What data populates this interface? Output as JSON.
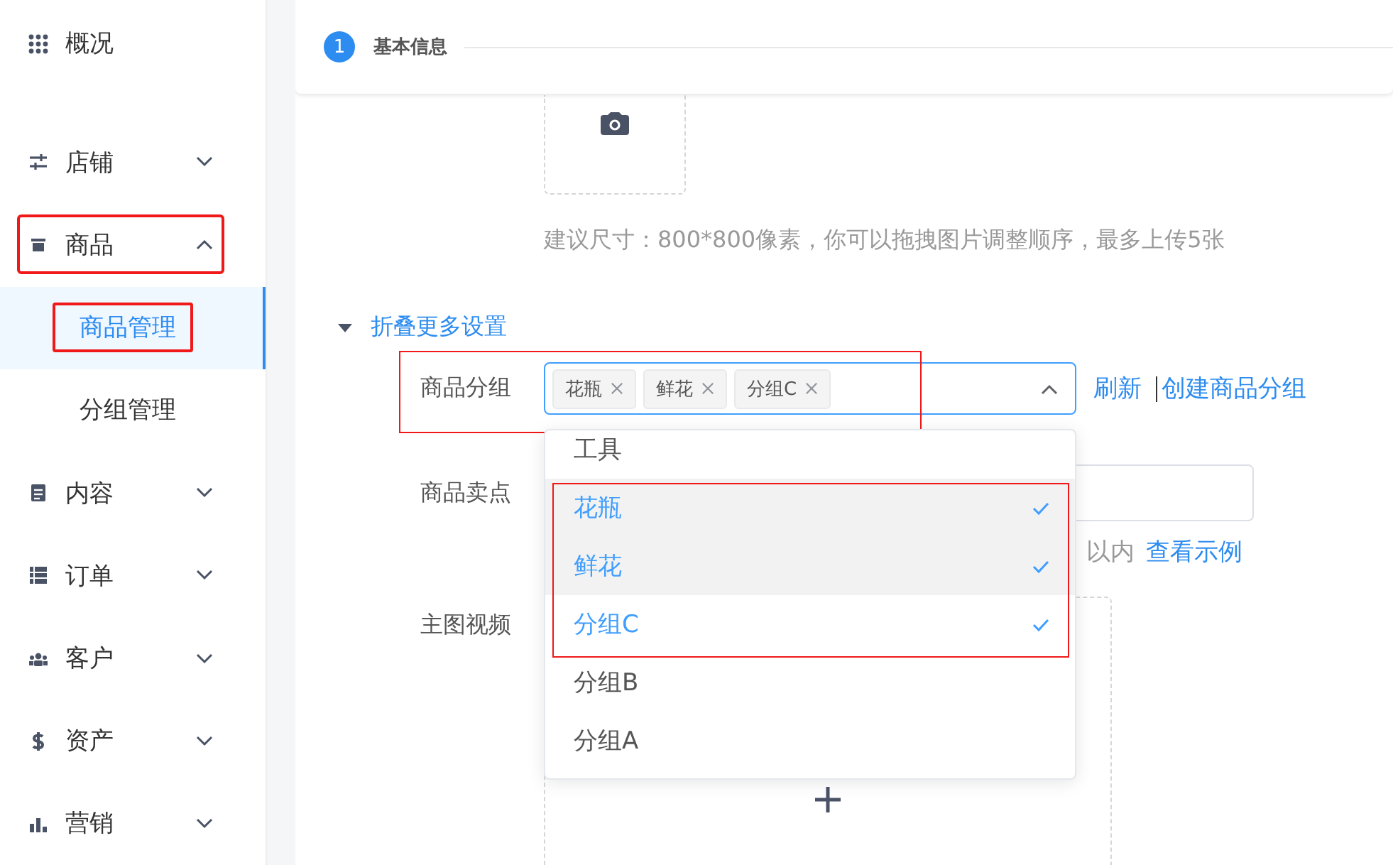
{
  "sidebar": {
    "items": [
      {
        "label": "概况",
        "highlighted": false
      },
      {
        "label": "店铺",
        "expanded": false,
        "highlighted": false
      },
      {
        "label": "商品",
        "expanded": true,
        "highlighted": true,
        "children": [
          {
            "label": "商品管理",
            "selected": true,
            "highlighted": true
          },
          {
            "label": "分组管理",
            "selected": false,
            "highlighted": false
          }
        ]
      },
      {
        "label": "内容",
        "expanded": false,
        "highlighted": false
      },
      {
        "label": "订单",
        "expanded": false,
        "highlighted": false
      },
      {
        "label": "客户",
        "expanded": false,
        "highlighted": false
      },
      {
        "label": "资产",
        "expanded": false,
        "highlighted": false
      },
      {
        "label": "营销",
        "expanded": false,
        "highlighted": false
      }
    ]
  },
  "step": {
    "number": "1",
    "title": "基本信息"
  },
  "upload_hint": "建议尺寸：800*800像素，你可以拖拽图片调整顺序，最多上传5张",
  "more_settings": {
    "label": "折叠更多设置",
    "expanded": true
  },
  "group_field": {
    "label": "商品分组",
    "highlighted": true,
    "tags": [
      "花瓶",
      "鲜花",
      "分组C"
    ],
    "open": true,
    "links": [
      "刷新",
      "创建商品分组"
    ],
    "options": [
      {
        "label": "工具",
        "selected": false,
        "highlighted": false
      },
      {
        "label": "花瓶",
        "selected": true,
        "highlighted": true
      },
      {
        "label": "鲜花",
        "selected": true,
        "highlighted": true
      },
      {
        "label": "分组C",
        "selected": true,
        "highlighted": true
      },
      {
        "label": "分组B",
        "selected": false,
        "highlighted": false
      },
      {
        "label": "分组A",
        "selected": false,
        "highlighted": false
      }
    ]
  },
  "selling_point": {
    "label": "商品卖点",
    "hint": "以内",
    "link": "查看示例"
  },
  "video_field": {
    "label": "主图视频"
  }
}
